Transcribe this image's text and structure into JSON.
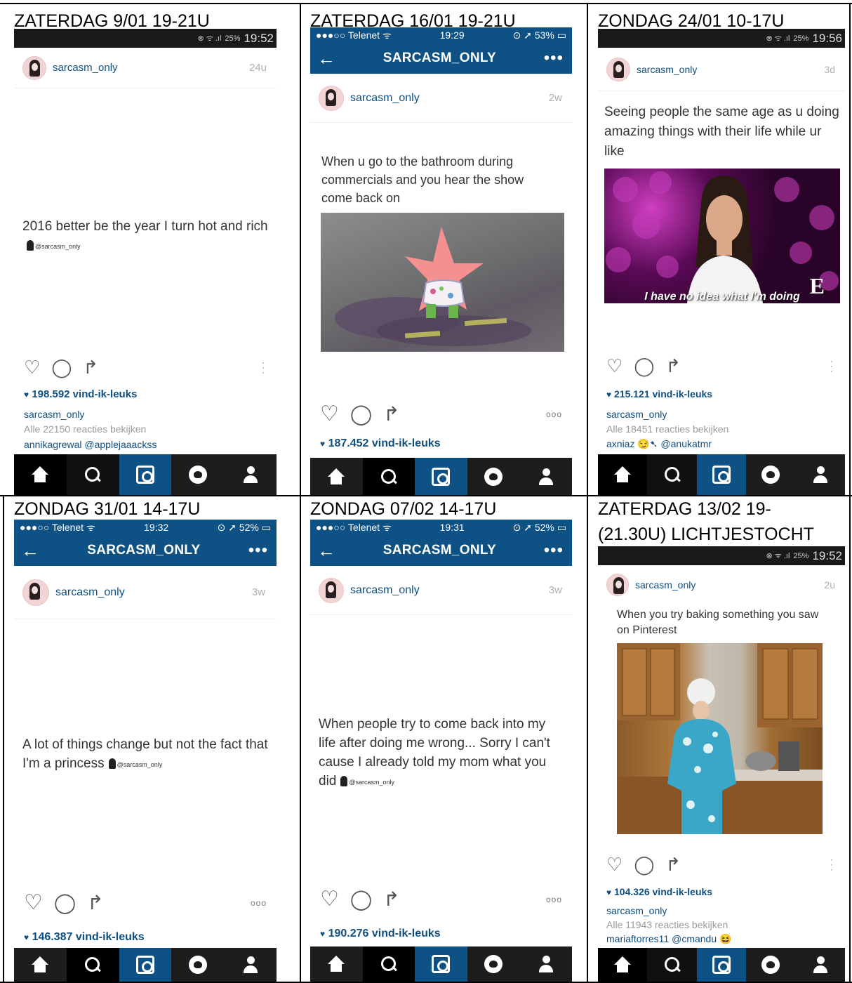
{
  "app": {
    "username": "sarcasm_only",
    "title": "SARCASM_ONLY",
    "watermark": "@sarcasm_only",
    "more_glyph": "•••",
    "back_glyph": "←",
    "dots_glyph": "ooo"
  },
  "icons": {
    "like": "heart-icon",
    "comment": "comment-icon",
    "share": "share-icon",
    "heart_small": "♥",
    "home": "home-icon",
    "search": "search-icon",
    "camera": "camera-icon",
    "activity": "activity-icon",
    "profile": "profile-icon"
  },
  "colors": {
    "brand_blue": "#0e5184",
    "link_blue": "#0e4f80",
    "status_bar": "#1a1a1a",
    "tab_bar": "#1d1d1d"
  },
  "cells": [
    {
      "header": "ZATERDAG 9/01 19-21U",
      "status": {
        "clock": "19:52",
        "battery": "25%",
        "icons": "⊗ ᯤ .ıl"
      },
      "time_ago": "24u",
      "caption": "2016 better be the year I turn hot and rich",
      "likes": "198.592 vind-ik-leuks",
      "lines": [
        "sarcasm_only",
        "Alle 22150 reacties bekijken",
        "annikagrewal @applejaaackss"
      ]
    },
    {
      "header": "ZATERDAG 16/01 19-21U",
      "status": {
        "carrier": "●●●○○ Telenet ᯤ",
        "clock": "19:29",
        "battery": "⊙ ➚ 53% ▭"
      },
      "time_ago": "2w",
      "caption": "When u go to the bathroom during commercials and you hear the show come back on",
      "likes": "187.452 vind-ik-leuks"
    },
    {
      "header": "ZONDAG 24/01 10-17U",
      "status": {
        "clock": "19:56",
        "battery": "25%",
        "icons": "⊗ ᯤ .ıl"
      },
      "time_ago": "3d",
      "caption": "Seeing people the same age as u doing amazing things with their life while ur like",
      "image_text": "I have no idea what I'm doing",
      "image_badge": "E",
      "likes": "215.121 vind-ik-leuks",
      "lines": [
        "sarcasm_only",
        "Alle 18451 reacties bekijken",
        "axniaz 😏➷ @anukatmr"
      ]
    },
    {
      "header": "ZONDAG 31/01 14-17U",
      "status": {
        "carrier": "●●●○○ Telenet ᯤ",
        "clock": "19:32",
        "battery": "⊙ ➚ 52% ▭"
      },
      "time_ago": "3w",
      "caption": "A lot of things change but not the fact that I'm a princess",
      "likes": "146.387 vind-ik-leuks"
    },
    {
      "header": "ZONDAG 07/02 14-17U",
      "status": {
        "carrier": "●●●○○ Telenet ᯤ",
        "clock": "19:31",
        "battery": "⊙ ➚ 52% ▭"
      },
      "time_ago": "3w",
      "caption": "When people try to come back into my life after doing me wrong... Sorry I can't cause I already told my mom what you did",
      "likes": "190.276 vind-ik-leuks"
    },
    {
      "header": "ZATERDAG 13/02 19-\n(21.30U) LICHTJESTOCHT",
      "status": {
        "clock": "19:52",
        "battery": "25%",
        "icons": "⊗ ᯤ .ıl"
      },
      "time_ago": "2u",
      "caption": "When you try baking something you saw on Pinterest",
      "likes": "104.326 vind-ik-leuks",
      "lines": [
        "sarcasm_only",
        "Alle 11943 reacties bekijken",
        "mariaftorres11 @cmandu 😆"
      ]
    }
  ]
}
